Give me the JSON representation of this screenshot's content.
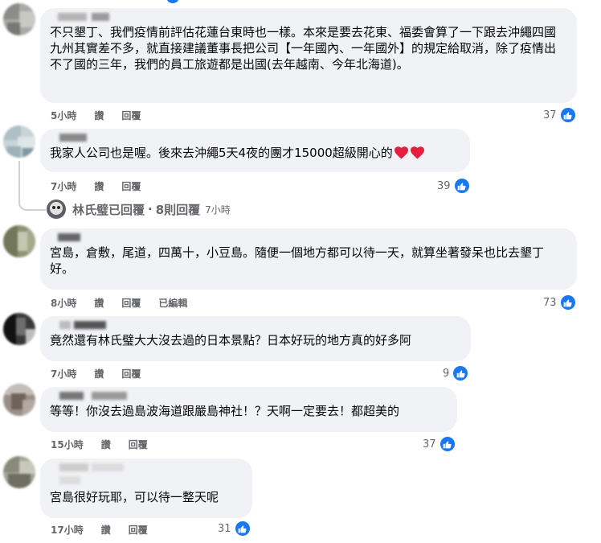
{
  "comments": [
    {
      "text": "不只墾丁、我們疫情前評估花蓮台東時也一樣。本來是要去花東、福委會算了一下跟去沖繩四國九州其實差不多，就直接建議董事長把公司【一年國內、一年國外】的規定給取消，除了疫情出不了國的三年，我們的員工旅遊都是出國(去年越南、今年北海道)。",
      "time": "5小時",
      "like": "讚",
      "reply": "回覆",
      "edited": "",
      "reactions": "37"
    },
    {
      "text": "我家人公司也是喔。後來去沖繩5天4夜的團才15000超級開心的",
      "time": "7小時",
      "like": "讚",
      "reply": "回覆",
      "edited": "",
      "reactions": "39"
    },
    {
      "text": "宮島，倉敷，尾道，四萬十，小豆島。隨便一個地方都可以待一天，就算坐著發呆也比去墾丁好。",
      "time": "8小時",
      "like": "讚",
      "reply": "回覆",
      "edited": "已編輯",
      "reactions": "73"
    },
    {
      "text": "竟然還有林氏璧大大沒去過的日本景點？日本好玩的地方真的好多阿",
      "time": "7小時",
      "like": "讚",
      "reply": "回覆",
      "edited": "",
      "reactions": "9"
    },
    {
      "text": "等等！你沒去過島波海道跟嚴島神社！？天啊一定要去！都超美的",
      "time": "15小時",
      "like": "讚",
      "reply": "回覆",
      "edited": "",
      "reactions": "37"
    },
    {
      "text": "宮島很好玩耶，可以待一整天呢",
      "time": "17小時",
      "like": "讚",
      "reply": "回覆",
      "edited": "",
      "reactions": "31"
    }
  ],
  "reply_summary": {
    "author": "林氏璧已回覆",
    "separator": "·",
    "count": "8則回覆",
    "time": "7小時"
  },
  "colors": {
    "bubble": "#f0f2f5",
    "meta": "#65676b",
    "like_blue": "#1877f2",
    "heart_red": "#e41e3f"
  },
  "icons": {
    "like": "thumbs-up-icon",
    "heart": "heart-icon"
  }
}
